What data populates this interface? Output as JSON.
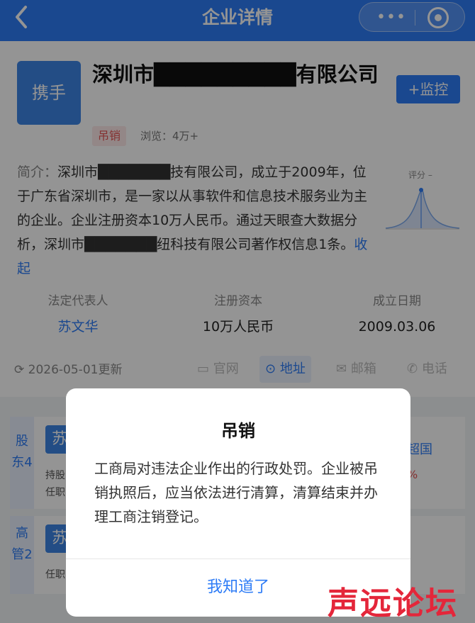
{
  "topbar": {
    "title": "企业详情",
    "back_icon": "chevron-left-icon",
    "more_label": "•••"
  },
  "company": {
    "logo_text": "携手",
    "name": "深圳市█████████有限公司",
    "monitor_label": "+监控",
    "status": "吊销",
    "views": "浏览：4万+",
    "intro_label": "简介：",
    "intro_text": "深圳市███████技有限公司，成立于2009年，位于广东省深圳市，是一家以从事软件和信息技术服务业为主的企业。企业注册资本10万人民币。通过天眼查大数据分析，深圳市███████纽科技有限公司著作权信息1条。",
    "collapse_label": "收起",
    "score_label": "评分 –"
  },
  "info": [
    {
      "key": "法定代表人",
      "value": "苏文华"
    },
    {
      "key": "注册资本",
      "value": "10万人民币"
    },
    {
      "key": "成立日期",
      "value": "2009.03.06"
    }
  ],
  "update_text": "2026-05-01更新",
  "contacts": [
    {
      "icon": "monitor-icon",
      "label": "官网"
    },
    {
      "icon": "location-icon",
      "label": "地址"
    },
    {
      "icon": "mail-icon",
      "label": "邮箱"
    },
    {
      "icon": "phone-icon",
      "label": "电话"
    }
  ],
  "lower": {
    "shareholders_tag": "股东4",
    "shareholder_avatar": "苏",
    "shareholder_line1": "持股",
    "shareholder_line2": "任职",
    "executives_tag": "高管2",
    "executive_avatar": "苏",
    "executive_line": "任职",
    "right_text1": "超国",
    "right_text2": "%"
  },
  "dialog": {
    "title": "吊销",
    "body": "工商局对违法企业作出的行政处罚。企业被吊销执照后，应当依法进行清算，清算结束并办理工商注销登记。",
    "confirm": "我知道了"
  },
  "watermark": "声远论坛",
  "colors": {
    "accent": "#2e7cf6",
    "danger": "#e55353",
    "watermark": "#e4263a"
  }
}
